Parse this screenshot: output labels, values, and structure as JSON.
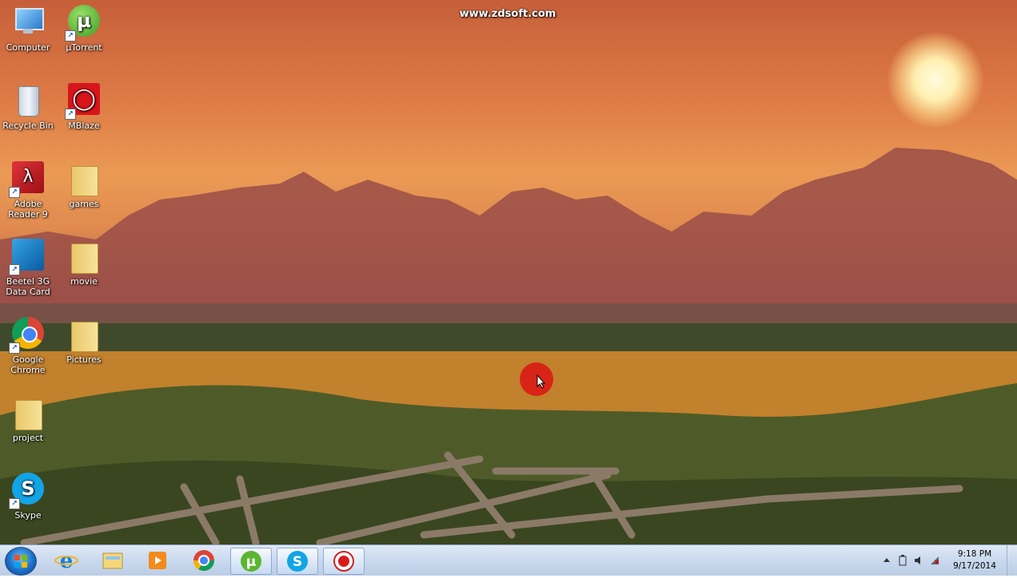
{
  "watermark": "www.zdsoft.com",
  "desktop_icons": [
    {
      "label": "Computer"
    },
    {
      "label": "µTorrent"
    },
    {
      "label": "Recycle Bin"
    },
    {
      "label": "MBlaze"
    },
    {
      "label": "Adobe Reader 9"
    },
    {
      "label": "games"
    },
    {
      "label": "Beetel 3G Data Card"
    },
    {
      "label": "movie"
    },
    {
      "label": "Google Chrome"
    },
    {
      "label": "Pictures"
    },
    {
      "label": "project"
    },
    {
      "label": "Skype"
    }
  ],
  "taskbar": {
    "pinned": [
      {
        "name": "internet-explorer"
      },
      {
        "name": "windows-explorer"
      },
      {
        "name": "media-player"
      },
      {
        "name": "google-chrome"
      },
      {
        "name": "utorrent"
      },
      {
        "name": "skype"
      },
      {
        "name": "screen-recorder"
      }
    ]
  },
  "clock": {
    "time": "9:18 PM",
    "date": "9/17/2014"
  }
}
